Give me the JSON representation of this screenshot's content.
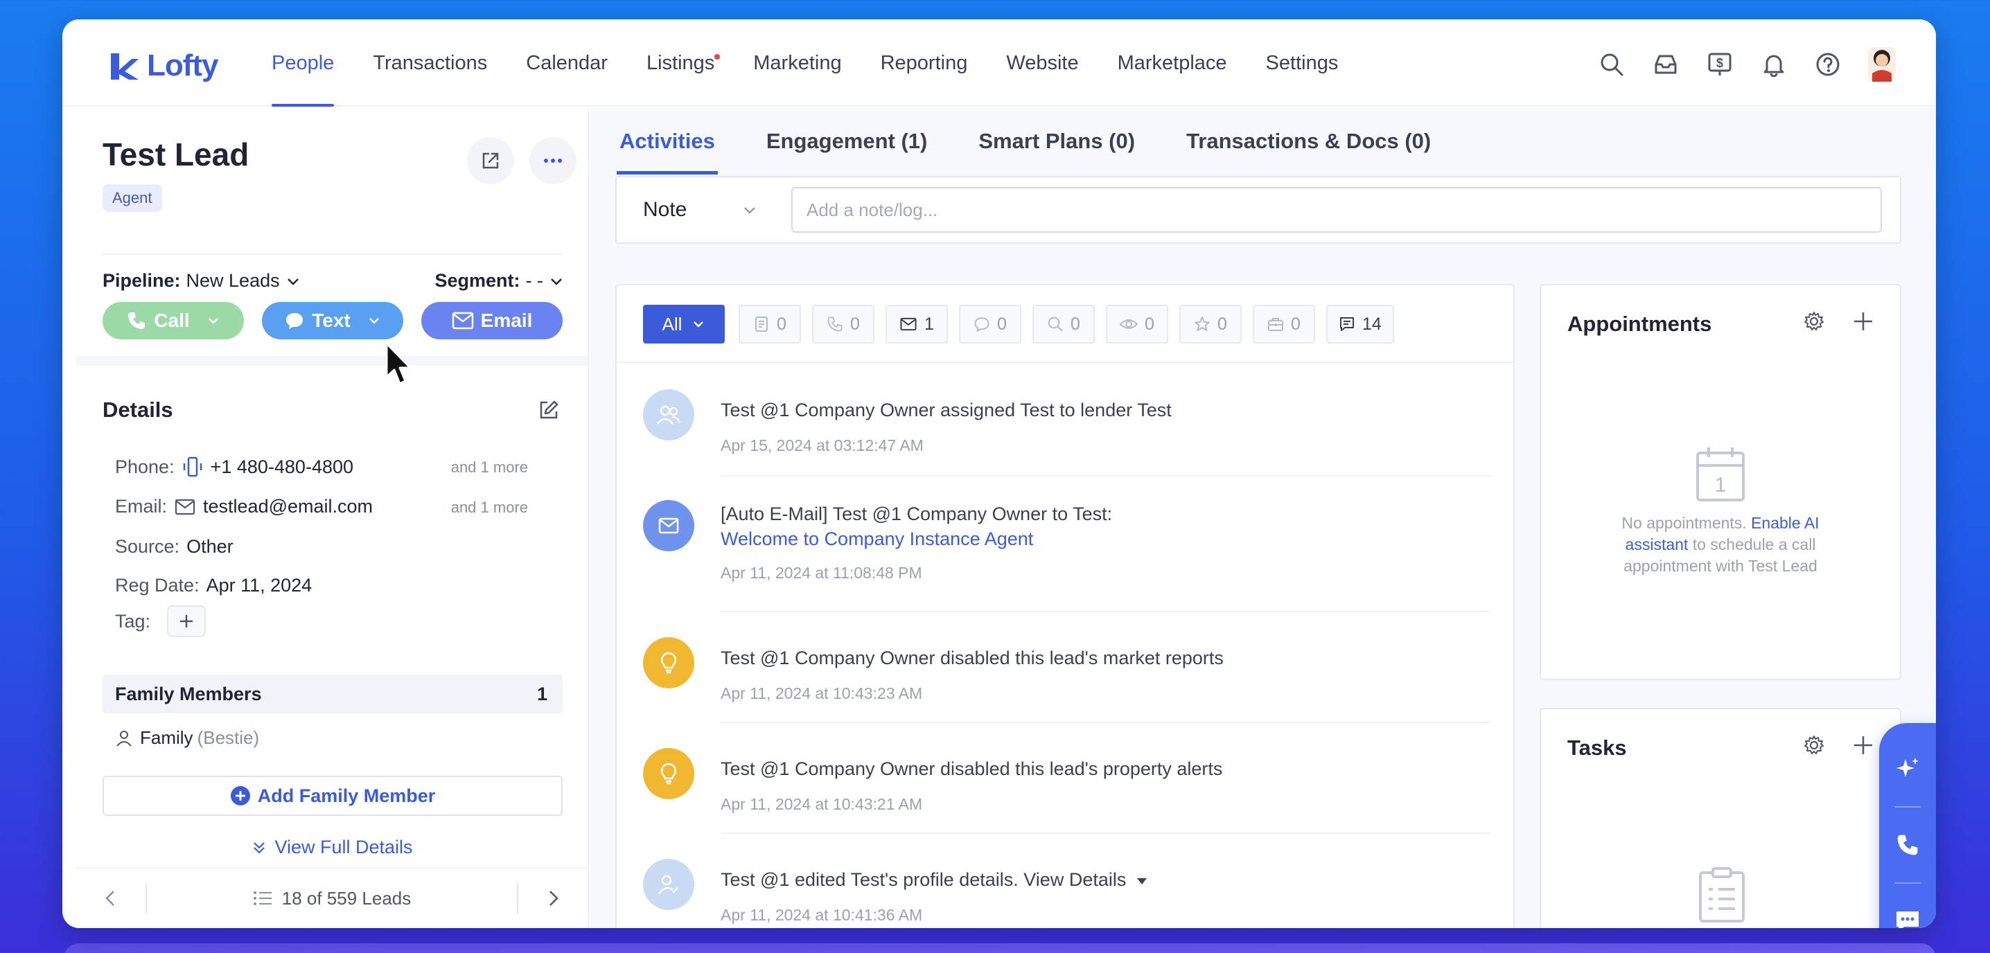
{
  "app": {
    "logo_text": "Lofty",
    "brand_color": "#3b5bdb"
  },
  "nav": {
    "items": [
      {
        "label": "People",
        "active": true
      },
      {
        "label": "Transactions"
      },
      {
        "label": "Calendar"
      },
      {
        "label": "Listings",
        "dot": true
      },
      {
        "label": "Marketing"
      },
      {
        "label": "Reporting"
      },
      {
        "label": "Website"
      },
      {
        "label": "Marketplace"
      },
      {
        "label": "Settings"
      }
    ],
    "icons": [
      "search-icon",
      "inbox-icon",
      "billing-icon",
      "bell-icon",
      "help-icon",
      "avatar"
    ]
  },
  "lead": {
    "name": "Test Lead",
    "role_badge": "Agent",
    "pipeline_label": "Pipeline:",
    "pipeline_value": "New Leads",
    "segment_label": "Segment:",
    "segment_value": "- -",
    "actions": {
      "call": "Call",
      "text": "Text",
      "email": "Email"
    }
  },
  "details": {
    "title": "Details",
    "phone_label": "Phone:",
    "phone": "+1 480-480-4800",
    "phone_more": "and 1 more",
    "email_label": "Email:",
    "email": "testlead@email.com",
    "email_more": "and 1 more",
    "source_label": "Source:",
    "source": "Other",
    "regdate_label": "Reg Date:",
    "regdate": "Apr 11, 2024",
    "tag_label": "Tag:"
  },
  "family": {
    "title": "Family Members",
    "count": "1",
    "member_name": "Family",
    "member_relation": "(Bestie)",
    "add_label": "Add Family Member",
    "view_full": "View Full Details"
  },
  "pager": {
    "text": "18 of 559 Leads"
  },
  "tabs": [
    {
      "label": "Activities",
      "active": true
    },
    {
      "label": "Engagement (1)"
    },
    {
      "label": "Smart Plans (0)"
    },
    {
      "label": "Transactions & Docs (0)"
    }
  ],
  "note": {
    "type": "Note",
    "placeholder": "Add a note/log..."
  },
  "filters": {
    "all": "All",
    "chips": [
      {
        "icon": "note-icon",
        "count": "0"
      },
      {
        "icon": "phone-icon",
        "count": "0"
      },
      {
        "icon": "mail-icon",
        "count": "1",
        "on": true
      },
      {
        "icon": "chat-icon",
        "count": "0"
      },
      {
        "icon": "search-icon",
        "count": "0"
      },
      {
        "icon": "eye-icon",
        "count": "0"
      },
      {
        "icon": "star-icon",
        "count": "0"
      },
      {
        "icon": "briefcase-icon",
        "count": "0"
      },
      {
        "icon": "message-icon",
        "count": "14",
        "on": true
      }
    ]
  },
  "activities": [
    {
      "kind": "assign",
      "text": "Test @1 Company Owner assigned Test to lender Test",
      "time": "Apr 15, 2024 at 03:12:47 AM"
    },
    {
      "kind": "email",
      "text": "[Auto E-Mail] Test @1 Company Owner to Test:",
      "link": "Welcome to Company Instance Agent",
      "time": "Apr 11, 2024 at 11:08:48 PM"
    },
    {
      "kind": "idea",
      "text": "Test @1 Company Owner disabled this lead's market reports",
      "time": "Apr 11, 2024 at 10:43:23 AM"
    },
    {
      "kind": "idea",
      "text": "Test @1 Company Owner disabled this lead's property alerts",
      "time": "Apr 11, 2024 at 10:43:21 AM"
    },
    {
      "kind": "profile",
      "text": "Test @1 edited Test's profile details. View Details",
      "time": "Apr 11, 2024 at 10:41:36 AM"
    }
  ],
  "appointments": {
    "title": "Appointments",
    "empty_pre": "No appointments.",
    "empty_link": "Enable AI assistant",
    "empty_post": "to schedule a call appointment with Test Lead"
  },
  "tasks": {
    "title": "Tasks"
  },
  "colors": {
    "call": "#9bd9a6",
    "text": "#5aa0f0",
    "email": "#6a83f0",
    "idea": "#f2b731",
    "assign": "#b9cff0",
    "fab": "#4a6cf0"
  }
}
